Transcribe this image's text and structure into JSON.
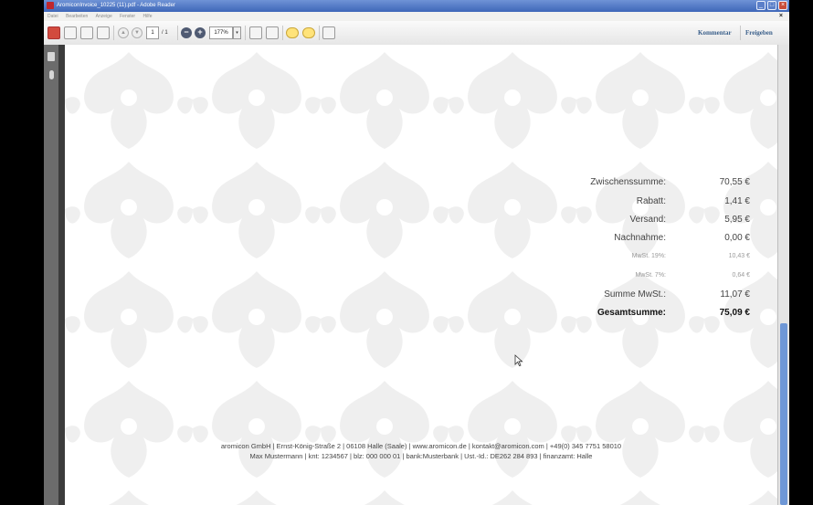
{
  "window": {
    "title": "AromiconInvoice_10225 (11).pdf - Adobe Reader",
    "minimize": "_",
    "restore": "□",
    "close": "×"
  },
  "menubar": {
    "items": [
      "Datei",
      "Bearbeiten",
      "Anzeige",
      "Fenster",
      "Hilfe"
    ],
    "close": "×"
  },
  "toolbar": {
    "page_current": "1",
    "page_total": "/ 1",
    "zoom": "177%",
    "zoom_out": "−",
    "zoom_in": "+",
    "dropdown": "▾",
    "prev": "▲",
    "next": "▼",
    "comment_label": "Kommentar",
    "share_label": "Freigeben"
  },
  "summary": {
    "rows": [
      {
        "label": "Zwischenssumme:",
        "value": "70,55 €"
      },
      {
        "label": "Rabatt:",
        "value": "1,41 €"
      },
      {
        "label": "Versand:",
        "value": "5,95 €"
      },
      {
        "label": "Nachnahme:",
        "value": "0,00 €"
      },
      {
        "label": "MwSt. 19%:",
        "value": "10,43 €"
      },
      {
        "label": "MwSt. 7%:",
        "value": "0,64 €"
      },
      {
        "label": "Summe MwSt.:",
        "value": "11,07 €"
      },
      {
        "label": "Gesamtsumme:",
        "value": "75,09 €"
      }
    ]
  },
  "footer": {
    "line1": "aromicon GmbH | Ernst-König-Straße 2 | 06108 Halle (Saale) | www.aromicon.de | kontakt@aromicon.com | +49(0) 345 7751 58010",
    "line2": "Max Mustermann | knt: 1234567 | blz:  000 000 01 | bank:Musterbank | Ust.-Id.: DE262 284 893 | finanzamt: Halle"
  },
  "icons": {
    "app": "adobe-reader-icon",
    "pages": "pages-panel-icon",
    "attachments": "paperclip-icon",
    "cursor": "mouse-pointer-icon"
  },
  "colors": {
    "titlebar": "#3e67b8",
    "link": "#3a5f8a",
    "scroll_thumb": "#6e97d6"
  }
}
